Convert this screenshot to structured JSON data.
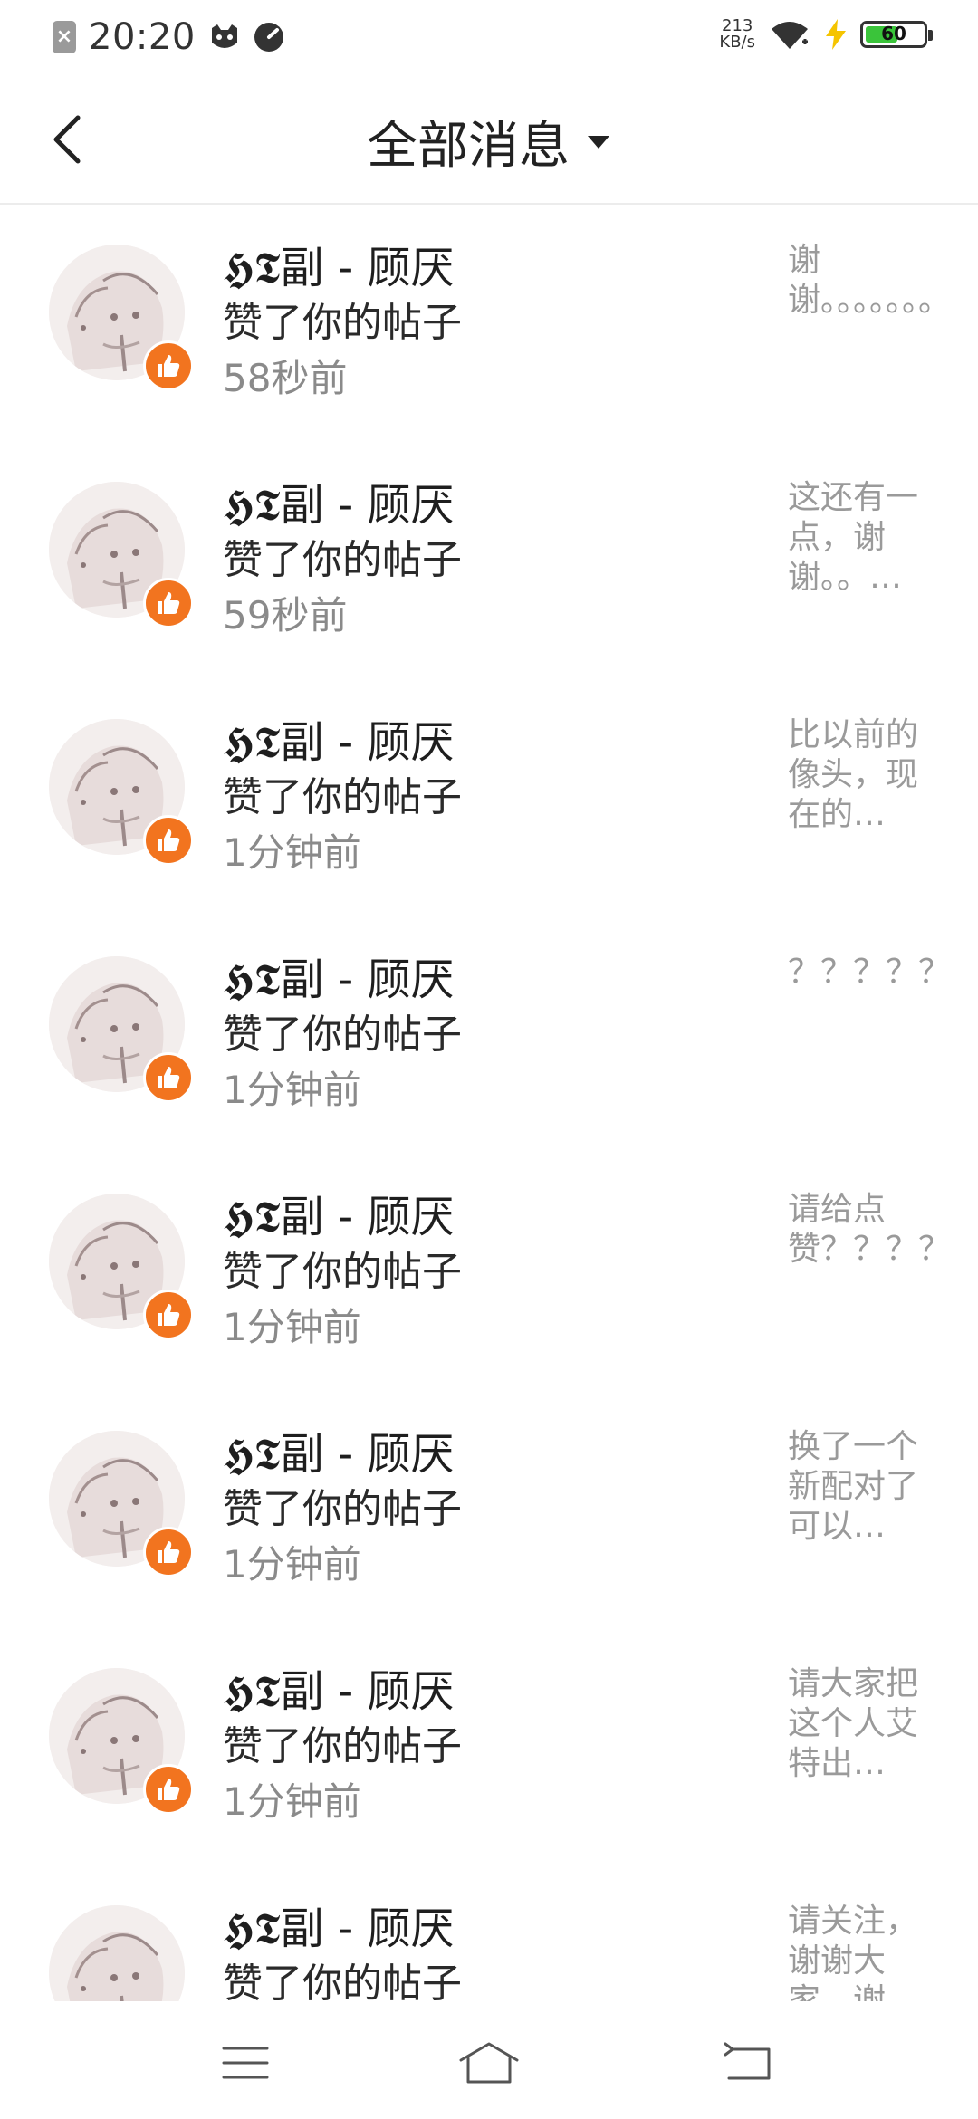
{
  "status_bar": {
    "time": "20:20",
    "net_speed_value": "213",
    "net_speed_unit": "KB/s",
    "battery": "60",
    "battery_level": 0.6,
    "battery_color": "#3ac43a"
  },
  "header": {
    "title": "全部消息"
  },
  "items": [
    {
      "name": "𝕳𝕿副 - 顾厌",
      "action": "赞了你的帖子",
      "time": "58秒前",
      "preview": "谢谢。。。。。。。。…"
    },
    {
      "name": "𝕳𝕿副 - 顾厌",
      "action": "赞了你的帖子",
      "time": "59秒前",
      "preview": "这还有一点，谢谢。。…"
    },
    {
      "name": "𝕳𝕿副 - 顾厌",
      "action": "赞了你的帖子",
      "time": "1分钟前",
      "preview": "比以前的像头，现在的…"
    },
    {
      "name": "𝕳𝕿副 - 顾厌",
      "action": "赞了你的帖子",
      "time": "1分钟前",
      "preview": "？？？？？？？？？？…"
    },
    {
      "name": "𝕳𝕿副 - 顾厌",
      "action": "赞了你的帖子",
      "time": "1分钟前",
      "preview": "请给点赞？？？？？？"
    },
    {
      "name": "𝕳𝕿副 - 顾厌",
      "action": "赞了你的帖子",
      "time": "1分钟前",
      "preview": "换了一个新配对了可以…"
    },
    {
      "name": "𝕳𝕿副 - 顾厌",
      "action": "赞了你的帖子",
      "time": "1分钟前",
      "preview": "请大家把这个人艾特出…"
    },
    {
      "name": "𝕳𝕿副 - 顾厌",
      "action": "赞了你的帖子",
      "time": "",
      "preview": "请关注，谢谢大家，谢"
    }
  ],
  "accent_color": "#f2741f"
}
